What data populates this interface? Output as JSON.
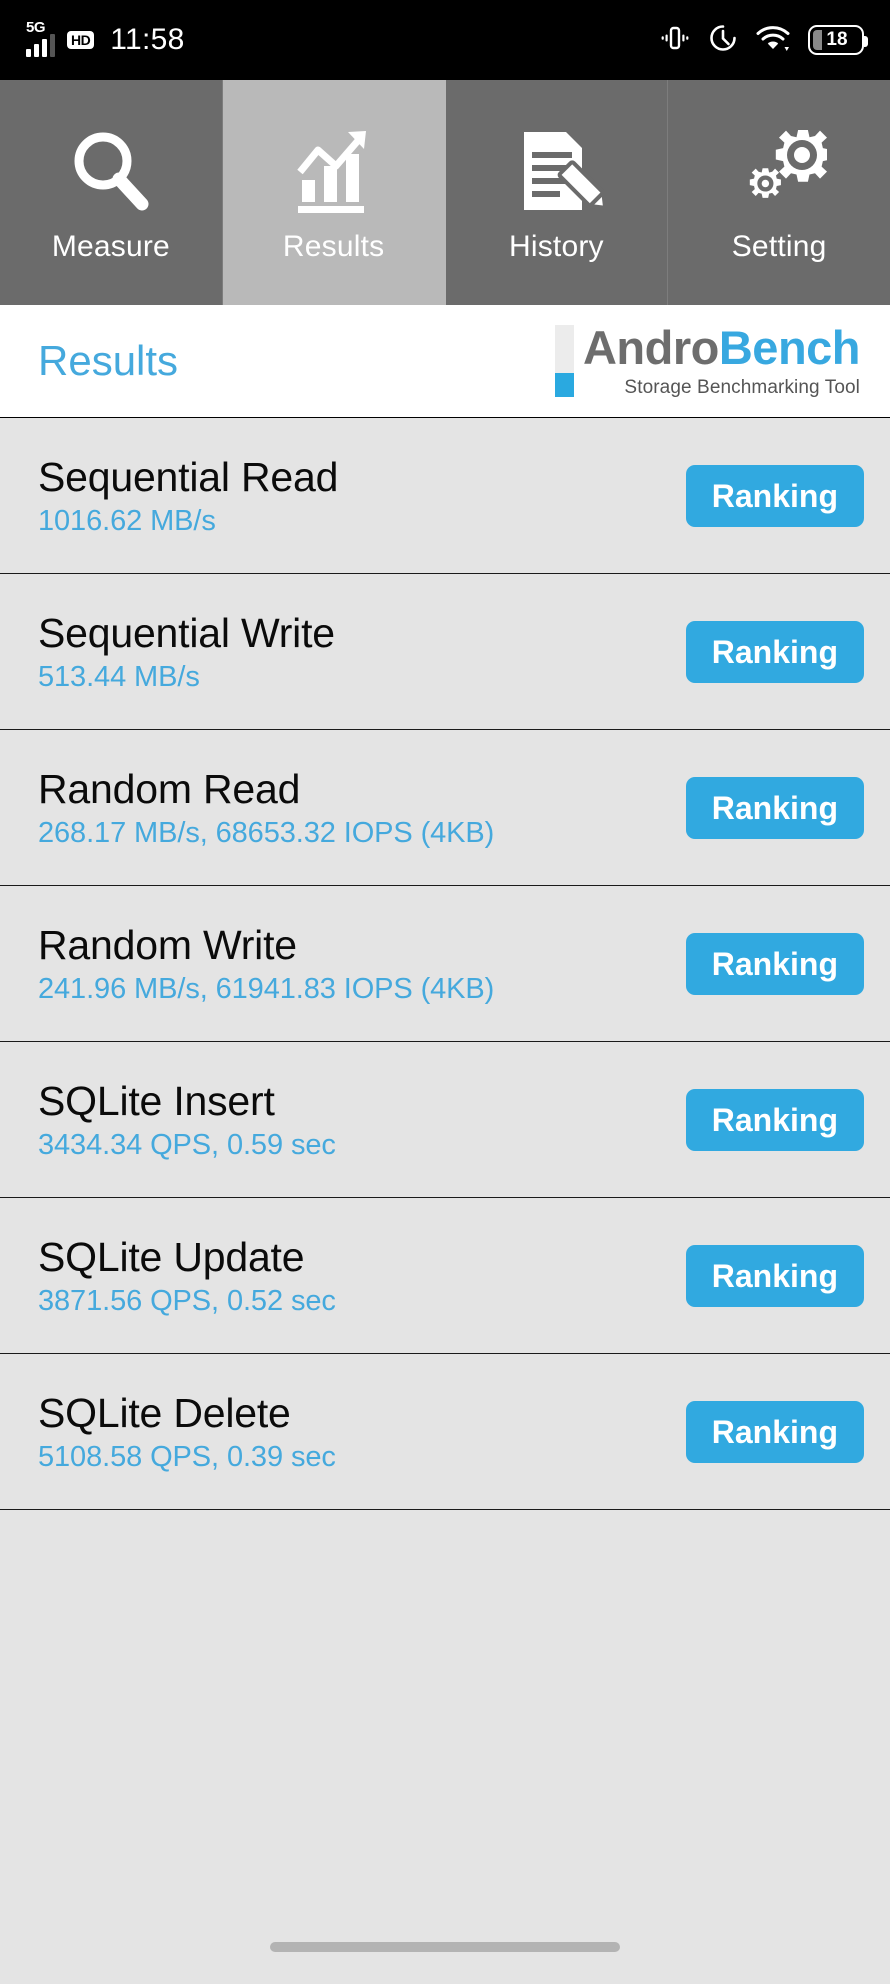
{
  "status_bar": {
    "network_type": "5G",
    "hd_badge": "HD",
    "time": "11:58",
    "battery_level": "18",
    "icons": [
      "signal-icon",
      "hd-icon",
      "vibrate-icon",
      "alarm-icon",
      "wifi-icon",
      "battery-icon"
    ]
  },
  "tabs": [
    {
      "label": "Measure",
      "icon": "magnifier-icon",
      "active": false
    },
    {
      "label": "Results",
      "icon": "bar-chart-icon",
      "active": true
    },
    {
      "label": "History",
      "icon": "document-pencil-icon",
      "active": false
    },
    {
      "label": "Setting",
      "icon": "gears-icon",
      "active": false
    }
  ],
  "header": {
    "page_title": "Results",
    "logo_part1": "Andro",
    "logo_part2": "Bench",
    "logo_subtitle": "Storage Benchmarking Tool"
  },
  "colors": {
    "accent_blue": "#45a9dd",
    "button_blue": "#31a9e0",
    "logo_gray": "#6d6d6d",
    "tab_inactive": "#6b6b6b",
    "tab_active": "#b9b9b9",
    "list_background": "#e4e4e4"
  },
  "results": {
    "button_label": "Ranking",
    "rows": [
      {
        "title": "Sequential Read",
        "value": "1016.62 MB/s"
      },
      {
        "title": "Sequential Write",
        "value": "513.44 MB/s"
      },
      {
        "title": "Random Read",
        "value": "268.17 MB/s, 68653.32 IOPS (4KB)"
      },
      {
        "title": "Random Write",
        "value": "241.96 MB/s, 61941.83 IOPS (4KB)"
      },
      {
        "title": "SQLite Insert",
        "value": "3434.34 QPS, 0.59 sec"
      },
      {
        "title": "SQLite Update",
        "value": "3871.56 QPS, 0.52 sec"
      },
      {
        "title": "SQLite Delete",
        "value": "5108.58 QPS, 0.39 sec"
      }
    ]
  }
}
